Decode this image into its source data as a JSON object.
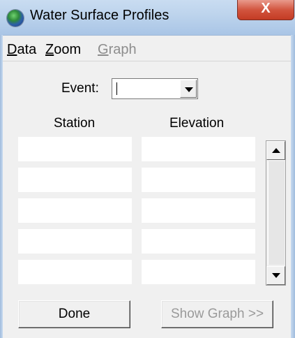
{
  "window": {
    "title": "Water Surface Profiles",
    "close_label": "X"
  },
  "menu": {
    "data": {
      "mnemonic": "D",
      "rest": "ata"
    },
    "zoom": {
      "mnemonic": "Z",
      "rest": "oom"
    },
    "graph": {
      "mnemonic": "G",
      "rest": "raph",
      "enabled": false
    }
  },
  "event": {
    "label": "Event:",
    "value": ""
  },
  "table": {
    "headers": {
      "station": "Station",
      "elevation": "Elevation"
    },
    "rows": [
      {
        "station": "",
        "elevation": ""
      },
      {
        "station": "",
        "elevation": ""
      },
      {
        "station": "",
        "elevation": ""
      },
      {
        "station": "",
        "elevation": ""
      },
      {
        "station": "",
        "elevation": ""
      }
    ]
  },
  "buttons": {
    "done": "Done",
    "show_graph": "Show Graph >>",
    "show_graph_enabled": false
  }
}
